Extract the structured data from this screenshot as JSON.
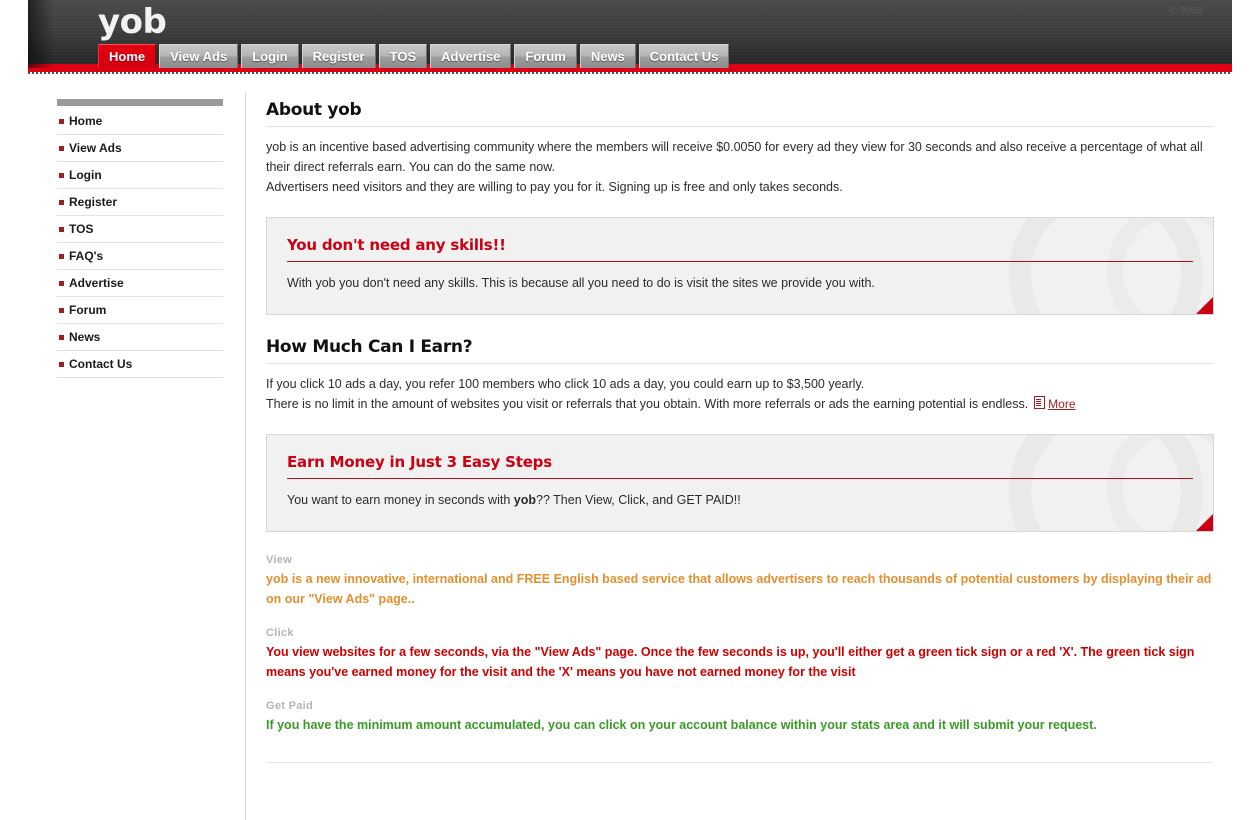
{
  "header": {
    "logo": "yob",
    "copyright": "© 2008",
    "tabs": [
      {
        "label": "Home",
        "active": true
      },
      {
        "label": "View Ads",
        "active": false
      },
      {
        "label": "Login",
        "active": false
      },
      {
        "label": "Register",
        "active": false
      },
      {
        "label": "TOS",
        "active": false
      },
      {
        "label": "Advertise",
        "active": false
      },
      {
        "label": "Forum",
        "active": false
      },
      {
        "label": "News",
        "active": false
      },
      {
        "label": "Contact Us",
        "active": false
      }
    ]
  },
  "sidebar": {
    "items": [
      {
        "label": "Home"
      },
      {
        "label": "View Ads"
      },
      {
        "label": "Login"
      },
      {
        "label": "Register"
      },
      {
        "label": "TOS"
      },
      {
        "label": "FAQ's"
      },
      {
        "label": "Advertise"
      },
      {
        "label": "Forum"
      },
      {
        "label": "News"
      },
      {
        "label": "Contact Us"
      }
    ]
  },
  "main": {
    "about": {
      "title": "About yob",
      "paragraph1": "yob is an incentive based advertising community where the members will receive $0.0050 for every ad they view for 30 seconds and also receive a percentage of what all their direct referrals earn. You can do the same now.",
      "paragraph2": "Advertisers need visitors and they are willing to pay you for it. Signing up is free and only takes seconds."
    },
    "skills_panel": {
      "title": "You don't need any skills!!",
      "text": "With yob you don't need any skills. This is because all you need to do is visit the sites we provide you with."
    },
    "earn": {
      "title": "How Much Can I Earn?",
      "paragraph1": "If you click 10 ads a day, you refer 100 members who click 10 ads a day, you could earn up to $3,500 yearly.",
      "paragraph2": "There is no limit in the amount of websites you visit or referrals that you obtain. With more referrals or ads the earning potential is endless.",
      "more_label": "More"
    },
    "steps_panel": {
      "title": "Earn Money in Just 3 Easy Steps",
      "text_before": "You want to earn money in seconds with ",
      "brand": "yob",
      "text_after": "?? Then View, Click, and GET PAID!!"
    },
    "steps": [
      {
        "label": "View",
        "brand": "yob",
        "text": " is a new innovative, international and FREE English based service that allows advertisers to reach thousands of potential customers by displaying their ad on our \"View Ads\" page..",
        "color": "#e2902f"
      },
      {
        "label": "Click",
        "brand": "",
        "text": "You view websites for a few seconds, via the \"View Ads\" page. Once the few seconds is up, you'll either get a green tick sign or a red 'X'. The green tick sign means you've earned money for the visit and the 'X' means you have not earned money for the visit",
        "color": "#cc0000"
      },
      {
        "label": "Get Paid",
        "brand": "",
        "text": "If you have the minimum amount accumulated, you can click on your account balance within your stats area and it will submit your request.",
        "color": "#3a9a28"
      }
    ]
  },
  "colors": {
    "accent_red": "#e00014",
    "panel_title_red": "#cc0013",
    "bullet_red": "#9b1f1f",
    "step_orange": "#e2902f",
    "step_green": "#3a9a28",
    "header_dark": "#3e3e3e"
  }
}
